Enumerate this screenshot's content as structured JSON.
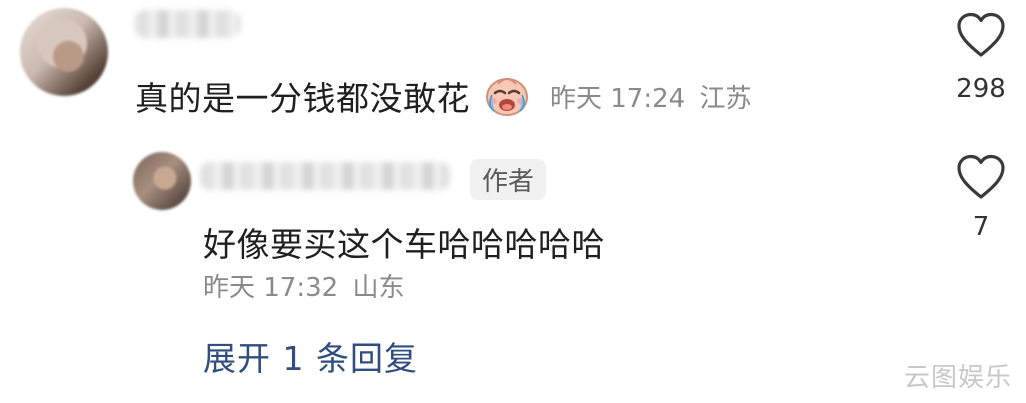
{
  "top_comment": {
    "text": "真的是一分钱都没敢花",
    "emoji_icon": "crying-laughing-face-icon",
    "time": "昨天 17:24",
    "location": "江苏",
    "likes": "298"
  },
  "reply": {
    "author_tag": "作者",
    "text": "好像要买这个车哈哈哈哈哈",
    "time": "昨天 17:32",
    "location": "山东",
    "likes": "7"
  },
  "expand_replies": "展开 1 条回复",
  "watermark": "云图娱乐",
  "colors": {
    "link": "#2f4d7e",
    "meta": "#8a8a8a",
    "tag_bg": "#f1f1f1"
  }
}
